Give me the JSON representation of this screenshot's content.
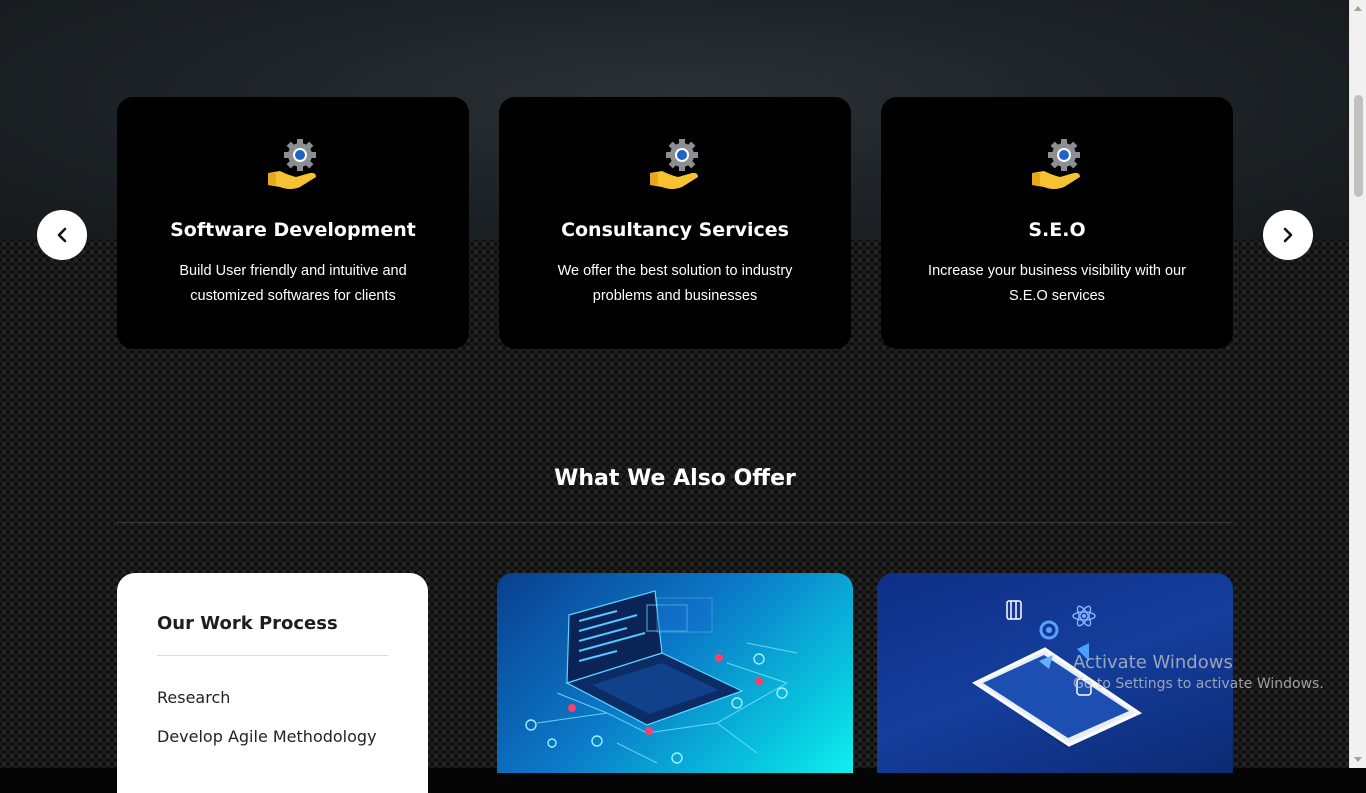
{
  "services": [
    {
      "title": "Software Development",
      "description": "Build User friendly and intuitive and customized softwares for clients",
      "icon": "gear-hand-icon"
    },
    {
      "title": "Consultancy Services",
      "description": "We offer the best solution to industry problems and businesses",
      "icon": "gear-hand-icon"
    },
    {
      "title": "S.E.O",
      "description": "Increase your business visibility with our S.E.O services",
      "icon": "gear-hand-icon"
    }
  ],
  "carousel": {
    "prev_icon": "chevron-left-icon",
    "next_icon": "chevron-right-icon"
  },
  "offer": {
    "title": "What We Also Offer"
  },
  "work_process": {
    "title": "Our Work Process",
    "items": [
      "Research",
      "Develop Agile Methodology"
    ]
  },
  "images": [
    "laptop-circuit-illustration",
    "mobile-frameworks-illustration"
  ],
  "watermark": {
    "line1": "Activate Windows",
    "line2": "Go to Settings to activate Windows."
  },
  "colors": {
    "accent_gear": "#1e63c8",
    "hand": "#f6c231",
    "card_bg": "#000000"
  }
}
